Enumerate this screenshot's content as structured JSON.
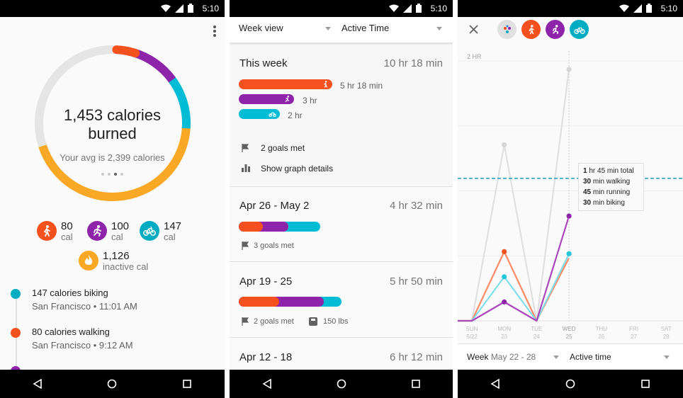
{
  "status": {
    "time": "5:10"
  },
  "panel1": {
    "calories_main": "1,453 calories",
    "calories_sub": "burned",
    "avg": "Your avg is 2,399 calories",
    "stats": [
      {
        "value": "80",
        "unit": "cal",
        "activity": "walking",
        "color": "#f4511e"
      },
      {
        "value": "100",
        "unit": "cal",
        "activity": "running",
        "color": "#8e24aa"
      },
      {
        "value": "147",
        "unit": "cal",
        "activity": "biking",
        "color": "#00acc1"
      },
      {
        "value": "1,126",
        "unit": "inactive cal",
        "activity": "inactive",
        "color": "#f9a825"
      }
    ],
    "timeline": [
      {
        "title": "147 calories biking",
        "sub": "San Francisco • 11:01 AM",
        "color": "#00acc1"
      },
      {
        "title": "80 calories walking",
        "sub": "San Francisco • 9:12 AM",
        "color": "#f4511e"
      },
      {
        "title": "",
        "sub": "",
        "color": "#8e24aa"
      }
    ]
  },
  "panel2": {
    "view_select": "Week view",
    "metric_select": "Active Time",
    "cards": [
      {
        "title": "This week",
        "total": "10 hr 18 min",
        "bars": [
          {
            "label": "5 hr 18 min",
            "color": "#f4511e"
          },
          {
            "label": "3 hr",
            "color": "#8e24aa"
          },
          {
            "label": "2 hr",
            "color": "#00bcd4"
          }
        ],
        "goals": "2 goals met",
        "graph_link": "Show graph details"
      },
      {
        "title": "Apr 26 - May 2",
        "total": "4 hr 32 min",
        "goals": "3 goals met"
      },
      {
        "title": "Apr 19 - 25",
        "total": "5 hr 50 min",
        "goals": "2 goals met",
        "weight": "150 lbs"
      },
      {
        "title": "Apr 12 - 18",
        "total": "6 hr 12 min"
      }
    ]
  },
  "panel3": {
    "y_label": "2 HR",
    "tooltip": {
      "total_h": "1",
      "total_rest": " hr 45 min total",
      "walk_v": "30",
      "walk_rest": " min walking",
      "run_v": "45",
      "run_rest": " min running",
      "bike_v": "30",
      "bike_rest": " min biking"
    },
    "week_label": "Week",
    "week_range": "May 22 - 28",
    "metric": "Active time"
  },
  "chart_data": {
    "type": "line",
    "categories": [
      "SUN 5/22",
      "MON 23",
      "TUE 24",
      "WED 25",
      "THU 26",
      "FRI 27",
      "SAT 28"
    ],
    "ylim": [
      0,
      120
    ],
    "y_tick_label": "2 HR",
    "goal_line": 68,
    "series": [
      {
        "name": "",
        "color": "#e0e0e0",
        "values": [
          0,
          84,
          0,
          120
        ]
      },
      {
        "name": "",
        "color": "#ff8a65",
        "values": [
          0,
          33,
          0,
          30
        ]
      },
      {
        "name": "",
        "color": "#80deea",
        "values": [
          0,
          21,
          0,
          32
        ]
      },
      {
        "name": "",
        "color": "#ab47bc",
        "values": [
          0,
          9,
          0,
          50
        ]
      }
    ],
    "points": [
      {
        "series": 0,
        "values": [
          null,
          84,
          null,
          120
        ],
        "color": "#d6d6d6"
      },
      {
        "series": 1,
        "values": [
          null,
          33,
          null,
          null
        ],
        "color": "#f4511e"
      },
      {
        "series": 2,
        "values": [
          null,
          21,
          null,
          32
        ],
        "color": "#26c6da"
      },
      {
        "series": 3,
        "values": [
          null,
          9,
          null,
          50
        ],
        "color": "#8e24aa"
      }
    ]
  }
}
